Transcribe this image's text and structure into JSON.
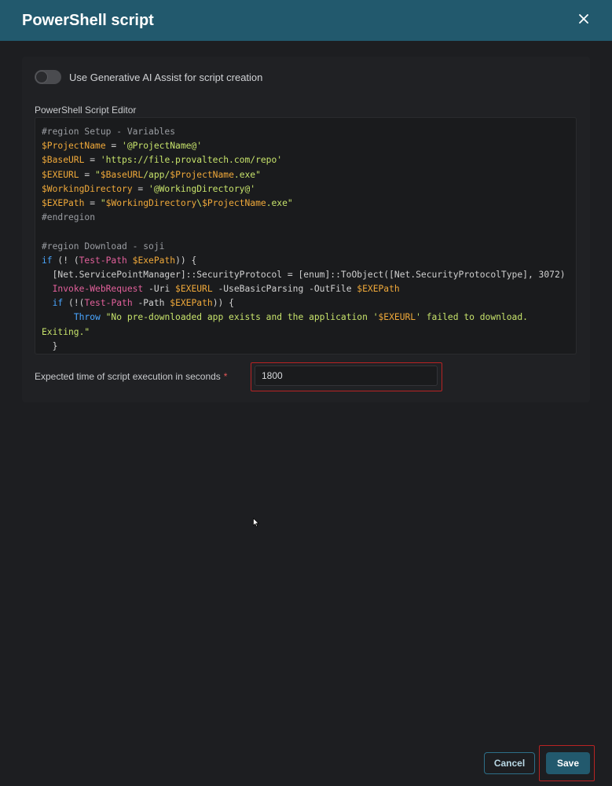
{
  "dialog": {
    "title": "PowerShell script"
  },
  "ai_toggle": {
    "label": "Use Generative AI Assist for script creation",
    "enabled": false
  },
  "editor": {
    "label": "PowerShell Script Editor",
    "lines": [
      [
        {
          "t": "#region Setup - Variables",
          "c": "comment"
        }
      ],
      [
        {
          "t": "$ProjectName",
          "c": "var"
        },
        {
          "t": " = ",
          "c": "plain"
        },
        {
          "t": "'@ProjectName@'",
          "c": "str"
        }
      ],
      [
        {
          "t": "$BaseURL",
          "c": "var"
        },
        {
          "t": " = ",
          "c": "plain"
        },
        {
          "t": "'https://file.provaltech.com/repo'",
          "c": "str"
        }
      ],
      [
        {
          "t": "$EXEURL",
          "c": "var"
        },
        {
          "t": " = ",
          "c": "plain"
        },
        {
          "t": "\"",
          "c": "str"
        },
        {
          "t": "$BaseURL",
          "c": "var"
        },
        {
          "t": "/app/",
          "c": "str"
        },
        {
          "t": "$ProjectName",
          "c": "var"
        },
        {
          "t": ".exe\"",
          "c": "str"
        }
      ],
      [
        {
          "t": "$WorkingDirectory",
          "c": "var"
        },
        {
          "t": " = ",
          "c": "plain"
        },
        {
          "t": "'@WorkingDirectory@'",
          "c": "str"
        }
      ],
      [
        {
          "t": "$EXEPath",
          "c": "var"
        },
        {
          "t": " = ",
          "c": "plain"
        },
        {
          "t": "\"",
          "c": "str"
        },
        {
          "t": "$WorkingDirectory",
          "c": "var"
        },
        {
          "t": "\\",
          "c": "str"
        },
        {
          "t": "$ProjectName",
          "c": "var"
        },
        {
          "t": ".exe\"",
          "c": "str"
        }
      ],
      [
        {
          "t": "#endregion",
          "c": "comment"
        }
      ],
      [
        {
          "t": "",
          "c": "plain"
        }
      ],
      [
        {
          "t": "#region Download - soji",
          "c": "comment"
        }
      ],
      [
        {
          "t": "if",
          "c": "kw"
        },
        {
          "t": " (! (",
          "c": "plain"
        },
        {
          "t": "Test-Path",
          "c": "cmd"
        },
        {
          "t": " ",
          "c": "plain"
        },
        {
          "t": "$ExePath",
          "c": "var"
        },
        {
          "t": ")) {",
          "c": "plain"
        }
      ],
      [
        {
          "t": "  [Net.ServicePointManager]",
          "c": "type"
        },
        {
          "t": "::SecurityProtocol = ",
          "c": "plain"
        },
        {
          "t": "[enum]",
          "c": "type"
        },
        {
          "t": "::ToObject(",
          "c": "plain"
        },
        {
          "t": "[Net.SecurityProtocolType]",
          "c": "type"
        },
        {
          "t": ", 3072)",
          "c": "plain"
        }
      ],
      [
        {
          "t": "  ",
          "c": "plain"
        },
        {
          "t": "Invoke-WebRequest",
          "c": "cmd"
        },
        {
          "t": " -Uri ",
          "c": "plain"
        },
        {
          "t": "$EXEURL",
          "c": "var"
        },
        {
          "t": " -UseBasicParsing -OutFile ",
          "c": "plain"
        },
        {
          "t": "$EXEPath",
          "c": "var"
        }
      ],
      [
        {
          "t": "  ",
          "c": "plain"
        },
        {
          "t": "if",
          "c": "kw"
        },
        {
          "t": " (!(",
          "c": "plain"
        },
        {
          "t": "Test-Path",
          "c": "cmd"
        },
        {
          "t": " -Path ",
          "c": "plain"
        },
        {
          "t": "$EXEPath",
          "c": "var"
        },
        {
          "t": ")) {",
          "c": "plain"
        }
      ],
      [
        {
          "t": "      ",
          "c": "plain"
        },
        {
          "t": "Throw",
          "c": "kw"
        },
        {
          "t": " \"No pre-downloaded app exists and the application '",
          "c": "str"
        },
        {
          "t": "$EXEURL",
          "c": "var"
        },
        {
          "t": "' failed to download.",
          "c": "str"
        }
      ],
      [
        {
          "t": "Exiting.\"",
          "c": "str"
        }
      ],
      [
        {
          "t": "  }",
          "c": "plain"
        }
      ]
    ]
  },
  "execution_time": {
    "label": "Expected time of script execution in seconds",
    "required_marker": "*",
    "value": "1800"
  },
  "footer": {
    "cancel_label": "Cancel",
    "save_label": "Save"
  },
  "colors": {
    "header_bg": "#22596d",
    "highlight_border": "#b82323",
    "required": "#e45757"
  },
  "icons": {
    "close": "close-icon",
    "cursor": "mouse-pointer-icon"
  }
}
